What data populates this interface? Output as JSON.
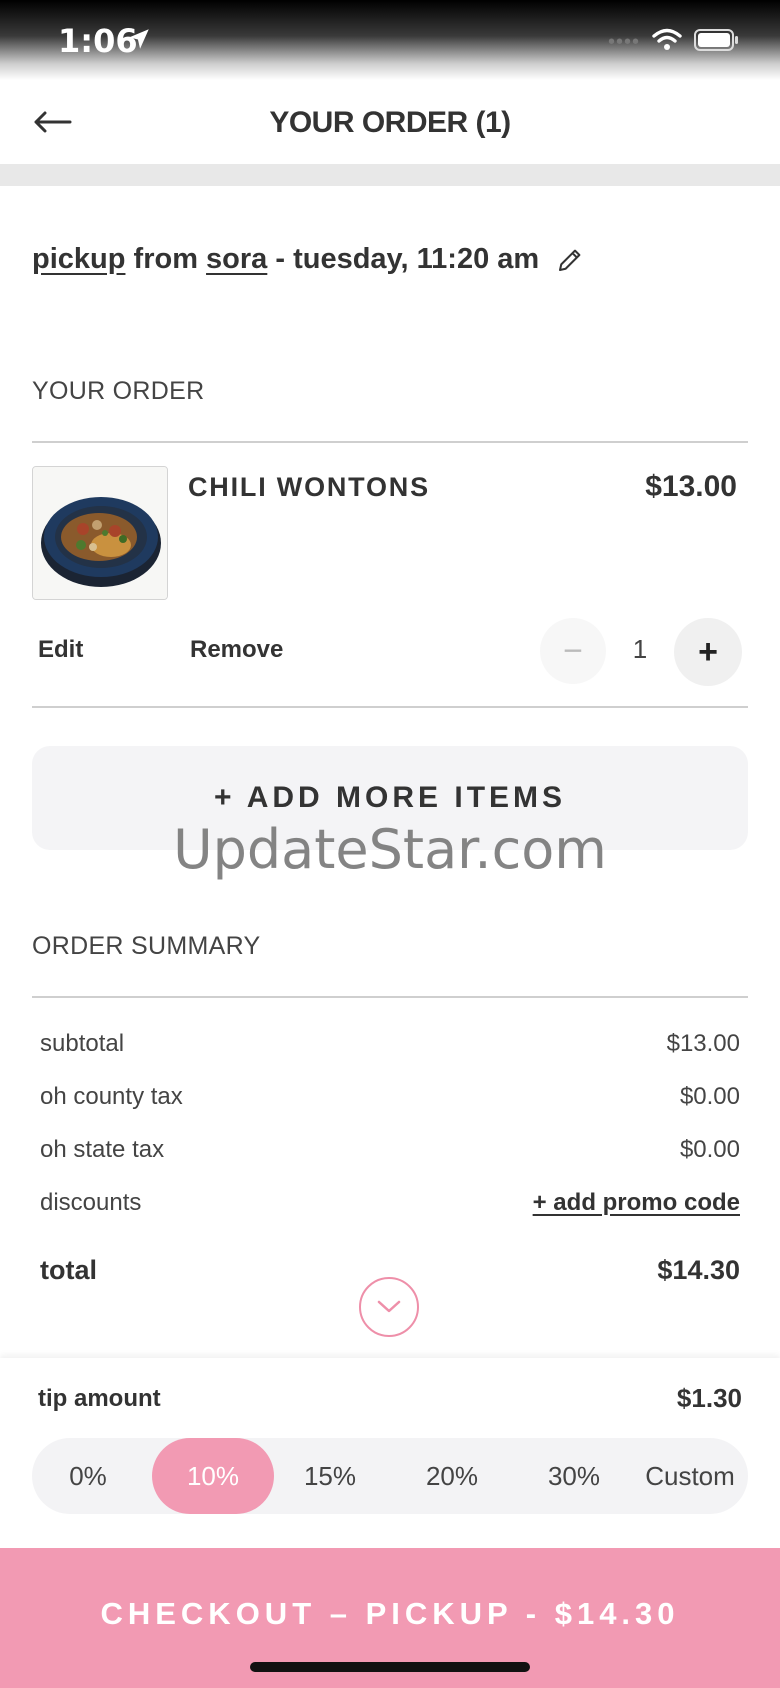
{
  "status": {
    "time": "1:06"
  },
  "nav": {
    "title": "YOUR ORDER (1)"
  },
  "pickup": {
    "mode": "pickup",
    "from": "from",
    "store": "sora",
    "when": "- tuesday, 11:20 am"
  },
  "order": {
    "heading": "YOUR ORDER",
    "items": [
      {
        "name": "CHILI WONTONS",
        "price": "$13.00",
        "qty": "1",
        "edit": "Edit",
        "remove": "Remove",
        "minus": "−",
        "plus": "+"
      }
    ]
  },
  "add_more": "+ ADD MORE ITEMS",
  "watermark": "UpdateStar.com",
  "summary": {
    "heading": "ORDER SUMMARY",
    "rows": [
      {
        "label": "subtotal",
        "value": "$13.00"
      },
      {
        "label": "oh county tax",
        "value": "$0.00"
      },
      {
        "label": "oh state tax",
        "value": "$0.00"
      }
    ],
    "discounts_label": "discounts",
    "promo": "+ add promo code",
    "total_label": "total",
    "total_value": "$14.30"
  },
  "tip": {
    "label": "tip amount",
    "value": "$1.30",
    "options": [
      "0%",
      "10%",
      "15%",
      "20%",
      "30%",
      "Custom"
    ],
    "selected": "10%"
  },
  "checkout": {
    "label": "CHECKOUT – PICKUP - $14.30"
  },
  "colors": {
    "accent": "#f29ab3",
    "accent_outline": "#ee8fa9"
  },
  "icons": [
    "location-arrow-icon",
    "wifi-icon",
    "battery-icon",
    "back-arrow-icon",
    "pencil-icon",
    "chevron-down-icon"
  ]
}
